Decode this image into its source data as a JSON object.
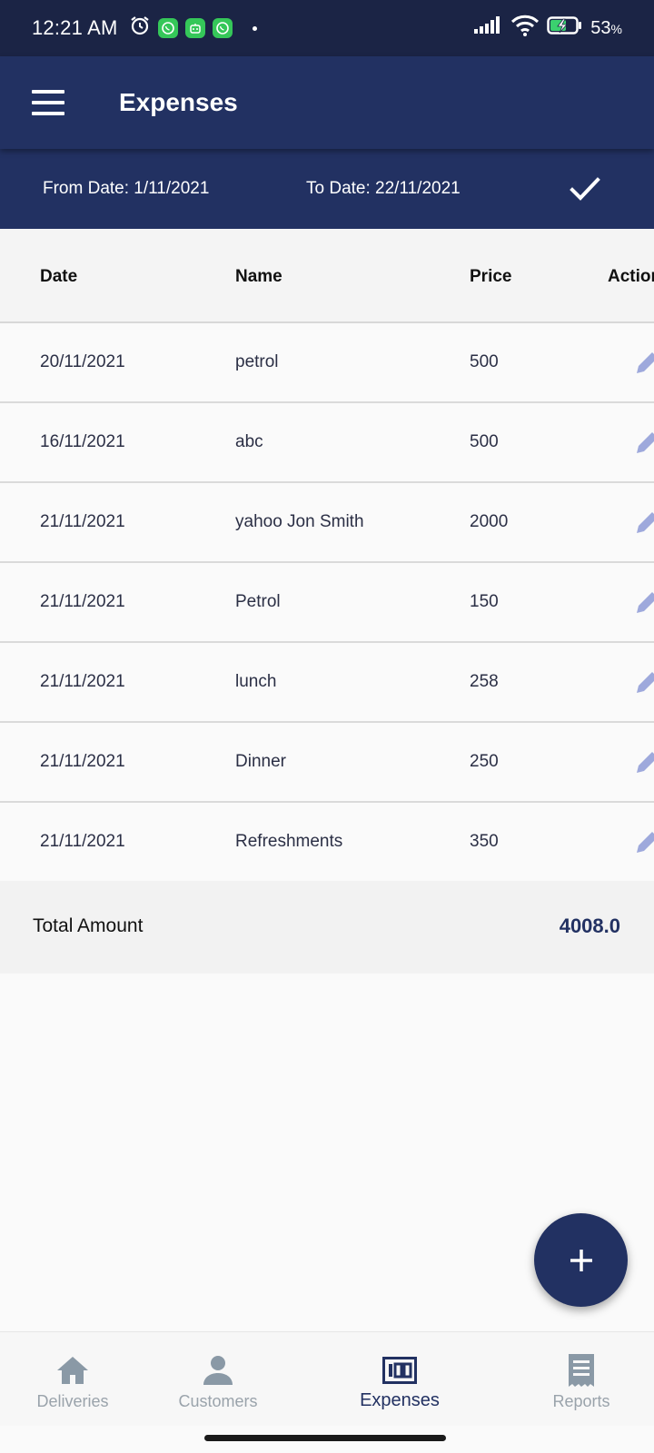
{
  "status_bar": {
    "time": "12:21 AM",
    "battery_percent": "53",
    "battery_symbol": "%"
  },
  "app_bar": {
    "title": "Expenses"
  },
  "date_filter": {
    "from_label": "From Date: 1/11/2021",
    "to_label": "To Date: 22/11/2021"
  },
  "table": {
    "headers": {
      "date": "Date",
      "name": "Name",
      "price": "Price",
      "action": "Action"
    },
    "rows": [
      {
        "date": "20/11/2021",
        "name": "petrol",
        "price": "500"
      },
      {
        "date": "16/11/2021",
        "name": "abc",
        "price": "500"
      },
      {
        "date": "21/11/2021",
        "name": "yahoo Jon Smith",
        "price": "2000"
      },
      {
        "date": "21/11/2021",
        "name": "Petrol",
        "price": "150"
      },
      {
        "date": "21/11/2021",
        "name": "lunch",
        "price": "258"
      },
      {
        "date": "21/11/2021",
        "name": "Dinner",
        "price": "250"
      },
      {
        "date": "21/11/2021",
        "name": "Refreshments",
        "price": "350"
      }
    ]
  },
  "total": {
    "label": "Total Amount",
    "value": "4008.0"
  },
  "bottom_nav": {
    "items": [
      {
        "label": "Deliveries",
        "icon": "home-icon"
      },
      {
        "label": "Customers",
        "icon": "person-icon"
      },
      {
        "label": "Expenses",
        "icon": "expenses-icon"
      },
      {
        "label": "Reports",
        "icon": "receipt-icon"
      }
    ],
    "active": "Expenses"
  },
  "colors": {
    "primary": "#223162",
    "status_bar": "#1b2445",
    "edit_icon": "#9ea9dc",
    "inactive_nav": "#9aa3ab"
  }
}
